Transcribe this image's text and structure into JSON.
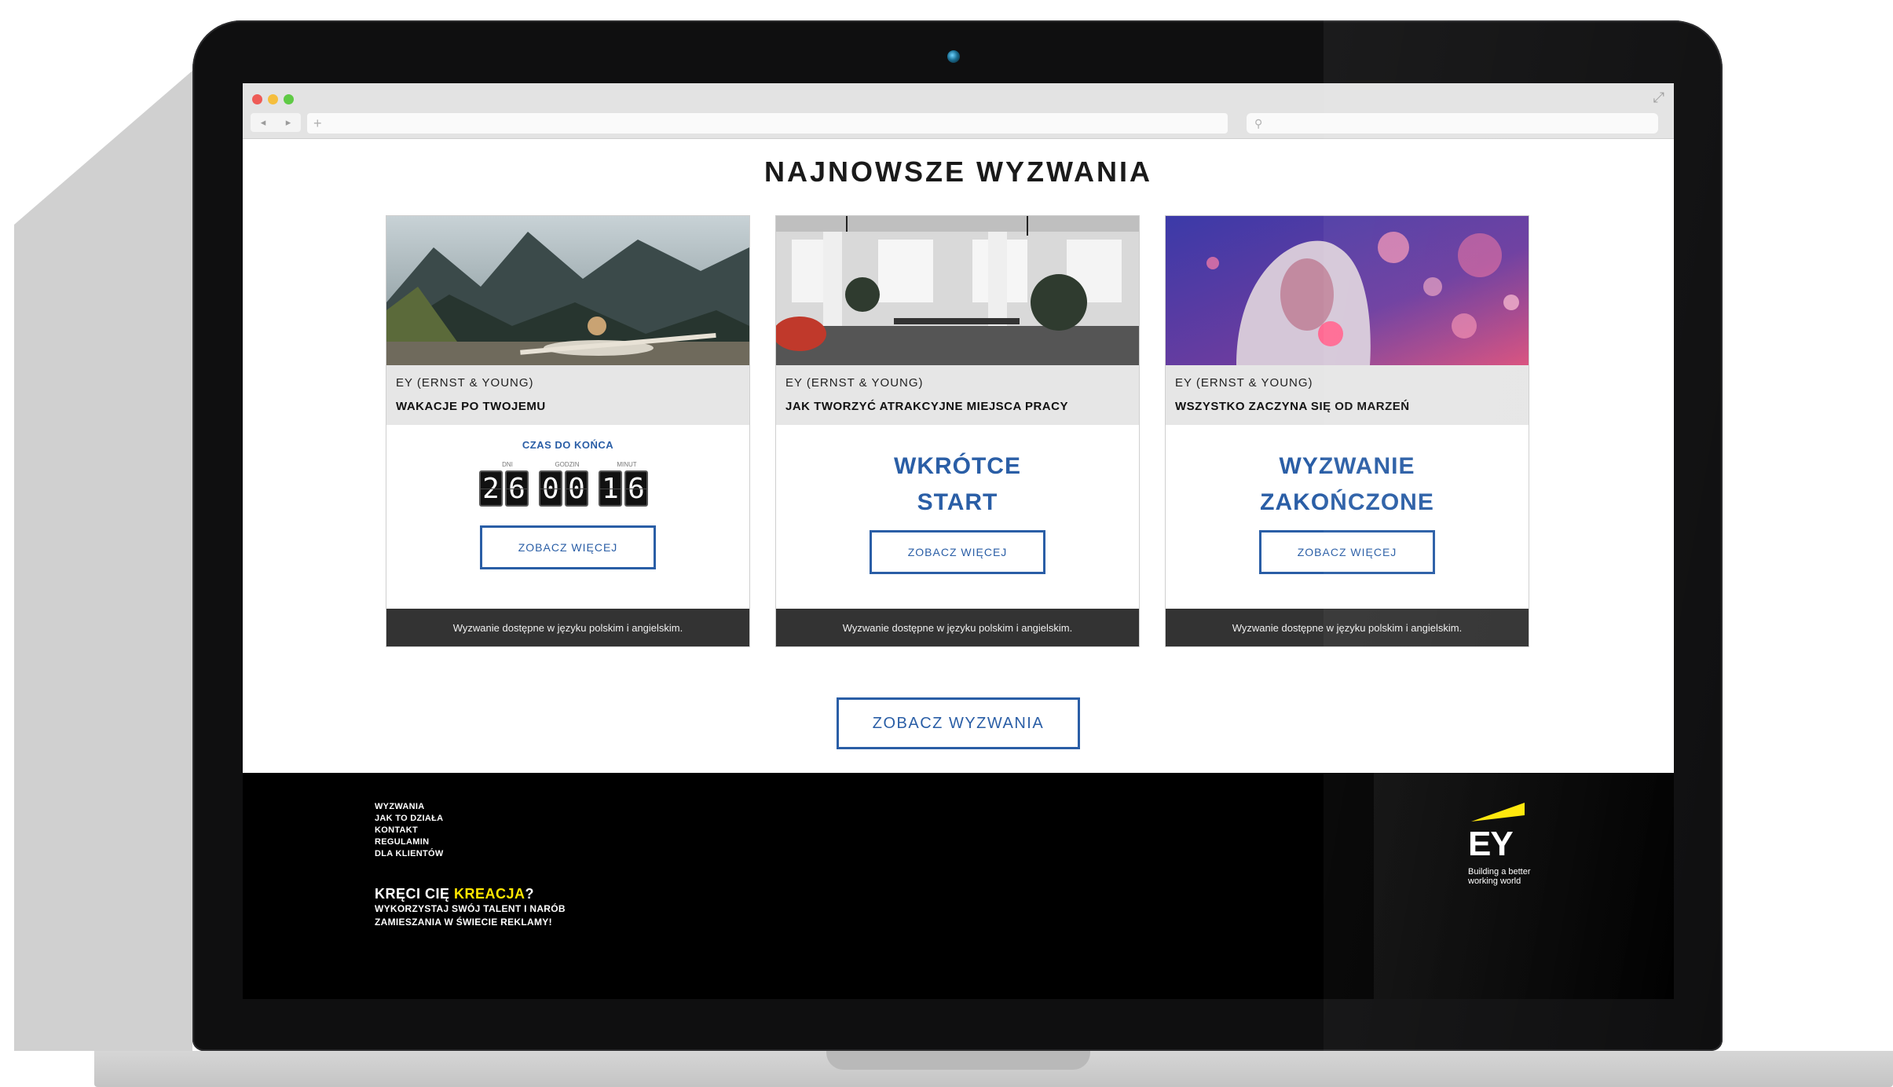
{
  "browser": {
    "url_placeholder": "+",
    "nav_back": "◂",
    "nav_forward": "▸",
    "search_icon": "⚲"
  },
  "page": {
    "title": "NAJNOWSZE WYZWANIA",
    "see_challenges": "ZOBACZ WYZWANIA"
  },
  "cards": [
    {
      "company": "EY (ERNST & YOUNG)",
      "title": "WAKACJE PO TWOJEMU",
      "countdown_label": "CZAS DO KOŃCA",
      "unit_days": "DNI",
      "unit_hours": "GODZIN",
      "unit_minutes": "MINUT",
      "digits": [
        "2",
        "6",
        "0",
        "0",
        "1",
        "6"
      ],
      "button": "ZOBACZ WIĘCEJ",
      "footer": "Wyzwanie dostępne w języku polskim i angielskim."
    },
    {
      "company": "EY (ERNST & YOUNG)",
      "title": "JAK TWORZYĆ ATRAKCYJNE MIEJSCA PRACY",
      "status_line1": "WKRÓTCE",
      "status_line2": "START",
      "button": "ZOBACZ WIĘCEJ",
      "footer": "Wyzwanie dostępne w języku polskim i angielskim."
    },
    {
      "company": "EY (ERNST & YOUNG)",
      "title": "WSZYSTKO ZACZYNA SIĘ OD MARZEŃ",
      "status_line1": "WYZWANIE",
      "status_line2": "ZAKOŃCZONE",
      "button": "ZOBACZ WIĘCEJ",
      "footer": "Wyzwanie dostępne w języku polskim i angielskim."
    }
  ],
  "footer": {
    "links": [
      "WYZWANIA",
      "JAK TO DZIAŁA",
      "KONTAKT",
      "REGULAMIN",
      "DLA KLIENTÓW"
    ],
    "tagline_prefix": "KRĘCI CIĘ ",
    "tagline_highlight": "KREACJA",
    "tagline_suffix": "?",
    "tagline_line2": "WYKORZYSTAJ SWÓJ TALENT I NARÓB",
    "tagline_line3": "ZAMIESZANIA W ŚWIECIE REKLAMY!",
    "logo_text": "EY",
    "logo_tagline_1": "Building a better",
    "logo_tagline_2": "working world"
  },
  "colors": {
    "accent_blue": "#2a5ea6",
    "ey_yellow": "#ffe600",
    "laptop_body": "#0f0f10"
  }
}
